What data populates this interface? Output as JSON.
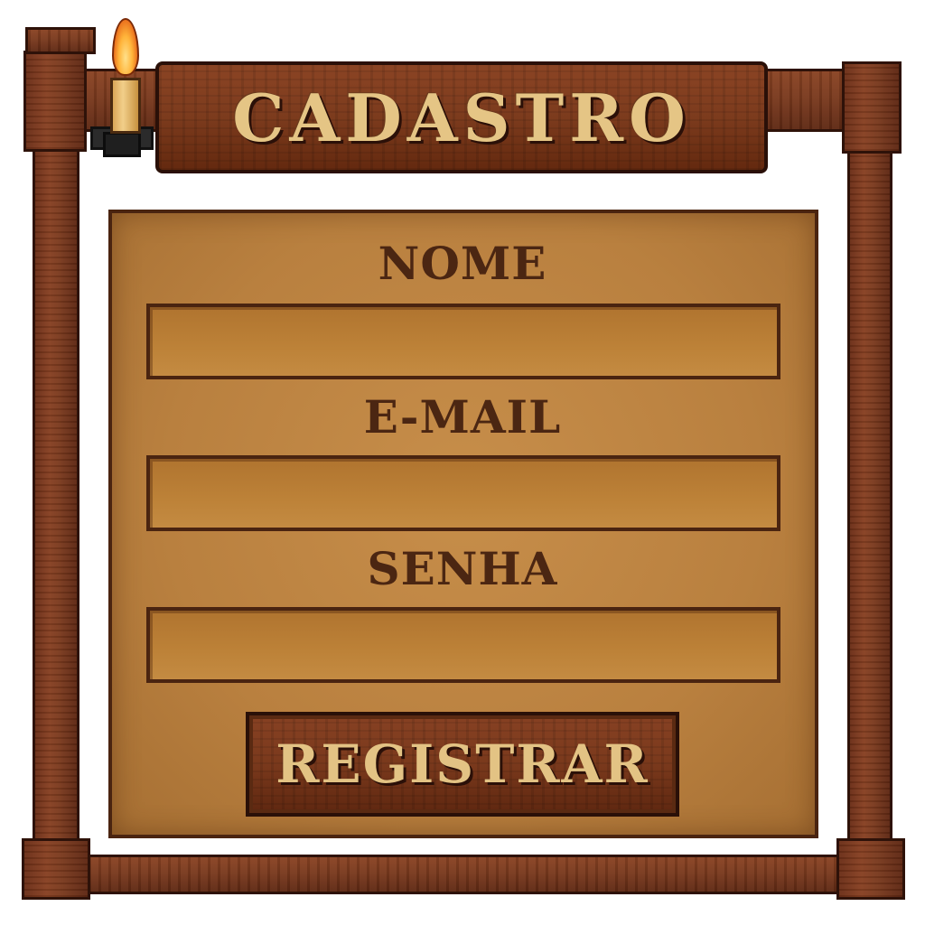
{
  "title": "CADASTRO",
  "form": {
    "fields": [
      {
        "label": "NOME",
        "value": "",
        "placeholder": ""
      },
      {
        "label": "E-MAIL",
        "value": "",
        "placeholder": ""
      },
      {
        "label": "SENHA",
        "value": "",
        "placeholder": ""
      }
    ],
    "submit_label": "REGISTRAR"
  },
  "decor": {
    "candle": "candle-icon",
    "frame": "wooden-frame"
  },
  "colors": {
    "wood": "#7a3a1e",
    "parchment": "#b9803f",
    "text_light": "#e5c585",
    "text_dark": "#4b2612"
  }
}
